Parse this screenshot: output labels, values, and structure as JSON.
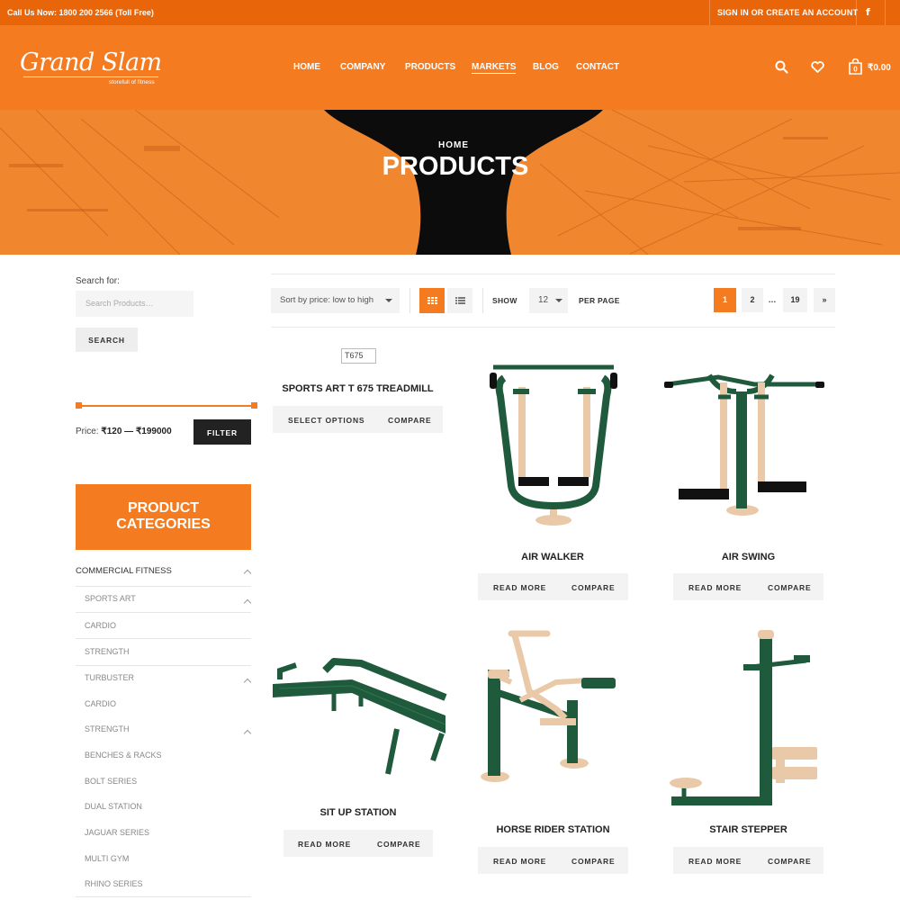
{
  "topbar": {
    "phone": "Call Us Now: 1800 200 2566 (Toll Free)",
    "account": "SIGN IN OR CREATE AN ACCOUNT",
    "facebook_icon": "f"
  },
  "header": {
    "logo_text": "Grand Slam",
    "tagline": "storefull of fitness",
    "nav": [
      "HOME",
      "COMPANY",
      "PRODUCTS",
      "MARKETS",
      "BLOG",
      "CONTACT"
    ],
    "active_nav": "MARKETS",
    "cart_count": "0",
    "cart_total": "₹0.00",
    "icons": [
      "search-icon",
      "heart-icon",
      "cart-icon"
    ]
  },
  "hero": {
    "breadcrumb": "HOME",
    "title": "PRODUCTS"
  },
  "sidebar": {
    "search_label": "Search for:",
    "search_placeholder": "Search Products…",
    "search_button": "SEARCH",
    "price_label": "Price:",
    "price_range": "₹120 — ₹199000",
    "filter_button": "FILTER",
    "categories_title_1": "PRODUCT",
    "categories_title_2": "CATEGORIES",
    "categories": [
      {
        "label": "COMMERCIAL FITNESS",
        "level": 0,
        "expanded": true
      },
      {
        "label": "SPORTS ART",
        "level": 1,
        "expanded": true
      },
      {
        "label": "CARDIO",
        "level": 1
      },
      {
        "label": "STRENGTH",
        "level": 1
      },
      {
        "label": "TURBUSTER",
        "level": 1,
        "expanded": true
      },
      {
        "label": "CARDIO",
        "level": 1
      },
      {
        "label": "STRENGTH",
        "level": 1,
        "expanded": true
      },
      {
        "label": "BENCHES & RACKS",
        "level": 1
      },
      {
        "label": "BOLT SERIES",
        "level": 1
      },
      {
        "label": "DUAL STATION",
        "level": 1
      },
      {
        "label": "JAGUAR SERIES",
        "level": 1
      },
      {
        "label": "MULTI GYM",
        "level": 1
      },
      {
        "label": "RHINO SERIES",
        "level": 1
      }
    ]
  },
  "toolbar": {
    "sort_value": "Sort by price: low to high",
    "show_label": "SHOW",
    "per_page_value": "12",
    "per_page_label": "PER PAGE",
    "pages": [
      "1",
      "2",
      "…",
      "19",
      "»"
    ],
    "current_page": "1"
  },
  "products": [
    {
      "name": "SPORTS ART T 675 TREADMILL",
      "image_alt": "T675",
      "btn1": "SELECT OPTIONS",
      "btn2": "COMPARE"
    },
    {
      "name": "AIR WALKER",
      "btn1": "READ MORE",
      "btn2": "COMPARE"
    },
    {
      "name": "AIR SWING",
      "btn1": "READ MORE",
      "btn2": "COMPARE"
    },
    {
      "name": "SIT UP STATION",
      "btn1": "READ MORE",
      "btn2": "COMPARE"
    },
    {
      "name": "HORSE RIDER STATION",
      "btn1": "READ MORE",
      "btn2": "COMPARE"
    },
    {
      "name": "STAIR STEPPER",
      "btn1": "READ MORE",
      "btn2": "COMPARE"
    }
  ],
  "colors": {
    "topbar": "#e8650a",
    "header": "#f47b20",
    "accent": "#f47b20",
    "equipment_green": "#1f5a3c",
    "equipment_beige": "#e9c9a8"
  }
}
